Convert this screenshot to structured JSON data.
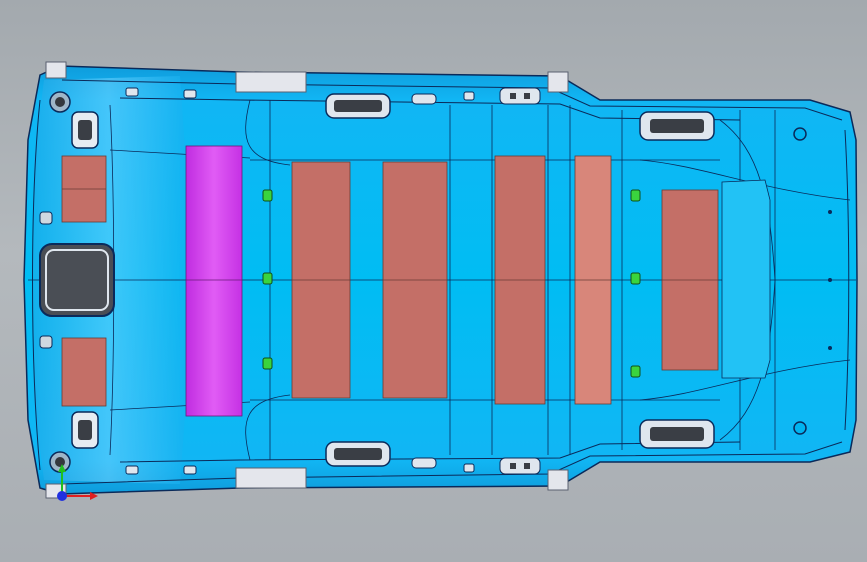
{
  "viewport": {
    "background_color": "#a9aeb3",
    "model": "vehicle-headliner-panel"
  },
  "colors": {
    "panel_fill": "#00b4f0",
    "panel_edge": "#0a2a5a",
    "pad_fill": "#c47068",
    "magenta_fill": "#d23ce8",
    "clip_fill": "#37d43a",
    "cutout_fill": "#4a4e55",
    "bracket_fill": "#e4e6ec"
  },
  "triad": {
    "x_axis_color": "#e02020",
    "y_axis_color": "#20c020",
    "z_axis_color": "#2030e0",
    "x_label": "",
    "y_label": ""
  }
}
